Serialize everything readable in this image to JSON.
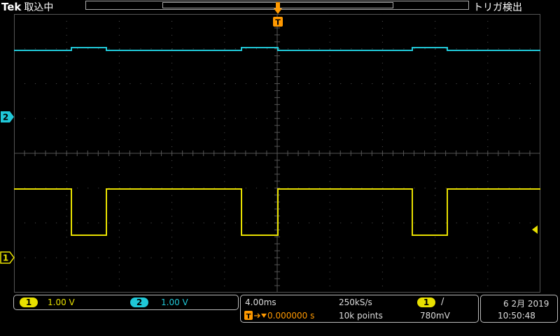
{
  "header": {
    "brand": "Tek",
    "acq_state": "取込中",
    "trigger_status": "トリガ検出"
  },
  "markers": {
    "trigger": "T",
    "ch2": "2",
    "ch1": "1"
  },
  "channels": [
    {
      "id": "1",
      "scale": "1.00 V",
      "color": "#e8e000"
    },
    {
      "id": "2",
      "scale": "1.00 V",
      "color": "#20c8d8"
    }
  ],
  "timebase": {
    "scale": "4.00ms",
    "sample_rate": "250kS/s",
    "trigger_position": "0.000000 s",
    "record_length": "10k points"
  },
  "trigger": {
    "source": "1",
    "slope_symbol": "/",
    "level": "780mV"
  },
  "clock": {
    "date": "6 2月 2019",
    "time": "10:50:48"
  },
  "colors": {
    "ch1": "#e8e000",
    "ch2": "#20c8d8",
    "trigger_marker": "#ff9900",
    "grid": "#555555"
  }
}
